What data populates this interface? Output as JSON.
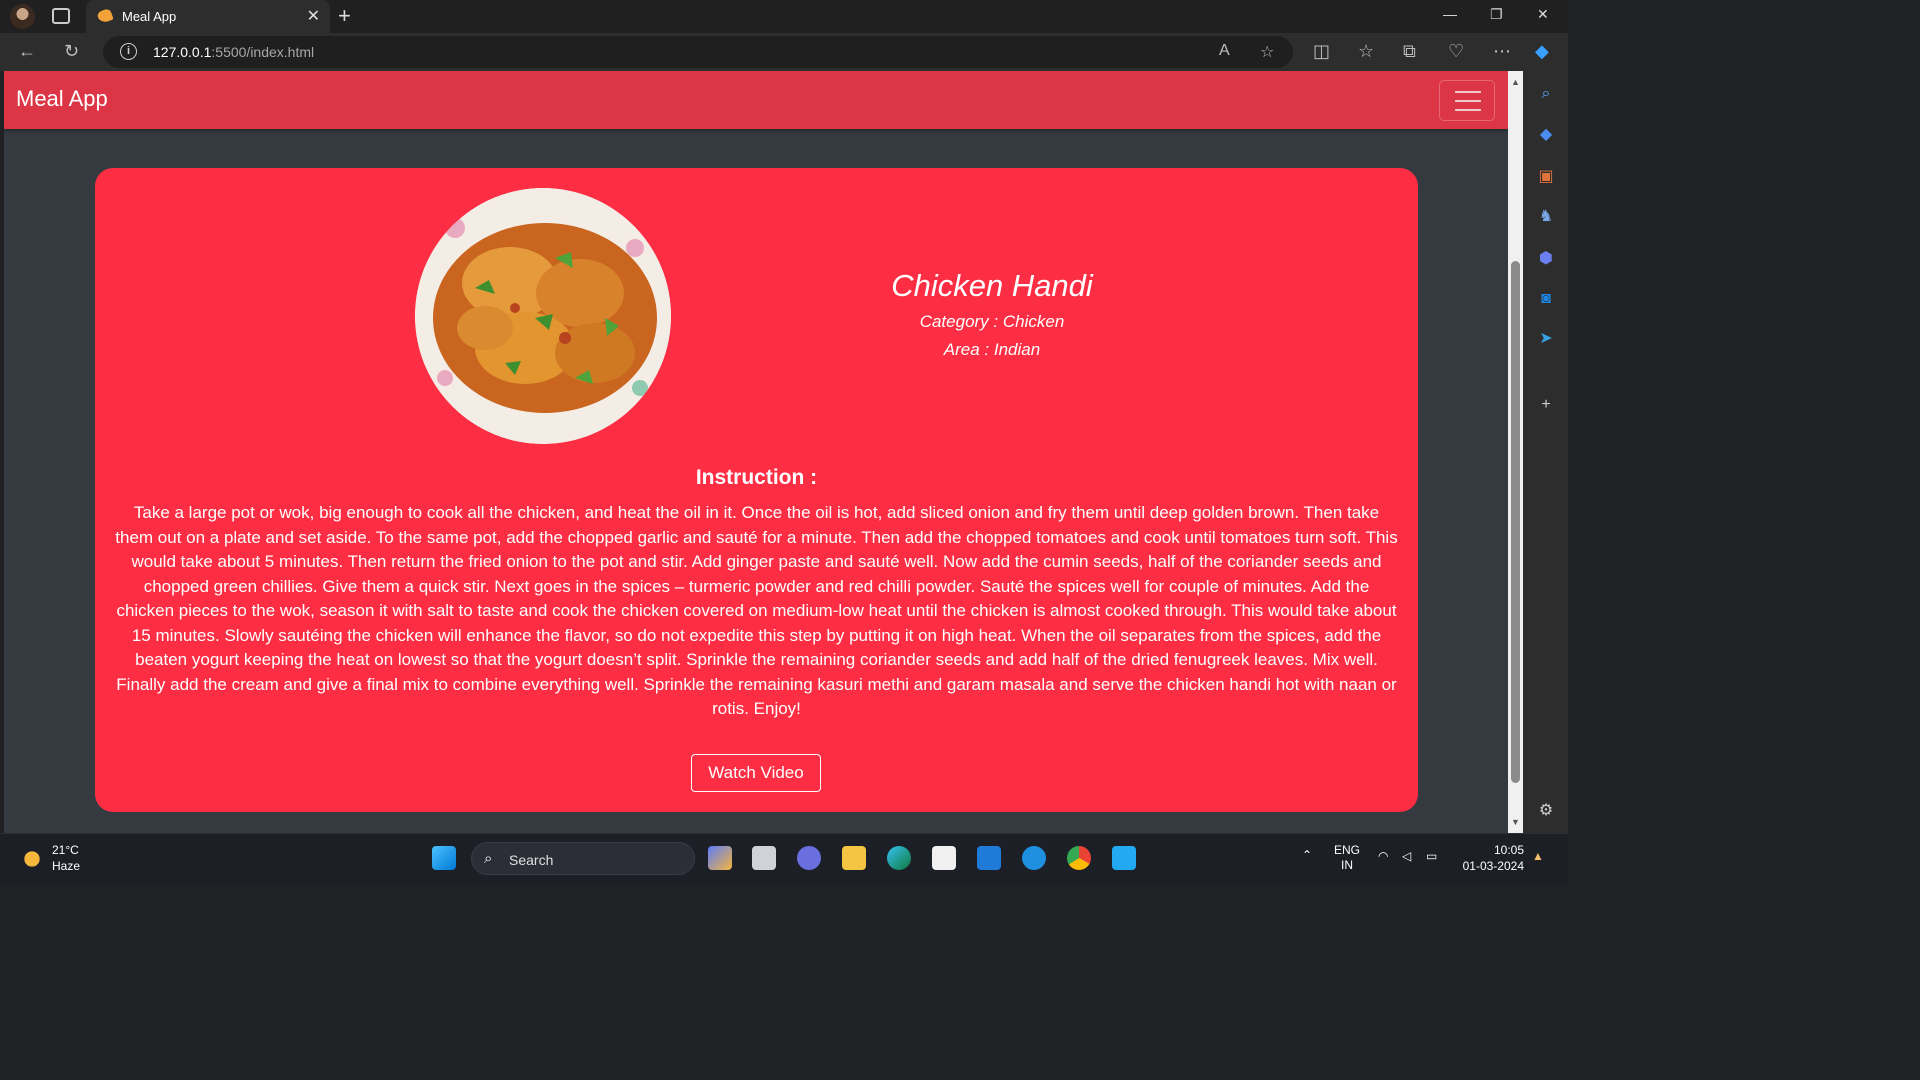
{
  "browser": {
    "tab_title": "Meal App",
    "url_host": "127.0.0.1",
    "url_rest": ":5500/index.html"
  },
  "app": {
    "brand": "Meal App"
  },
  "meal": {
    "name": "Chicken Handi",
    "category": "Category : Chicken",
    "area": "Area : Indian",
    "instruction_title": "Instruction :",
    "instructions": "Take a large pot or wok, big enough to cook all the chicken, and heat the oil in it. Once the oil is hot, add sliced onion and fry them until deep golden brown. Then take them out on a plate and set aside. To the same pot, add the chopped garlic and sauté for a minute. Then add the chopped tomatoes and cook until tomatoes turn soft. This would take about 5 minutes. Then return the fried onion to the pot and stir. Add ginger paste and sauté well. Now add the cumin seeds, half of the coriander seeds and chopped green chillies. Give them a quick stir. Next goes in the spices – turmeric powder and red chilli powder. Sauté the spices well for couple of minutes. Add the chicken pieces to the wok, season it with salt to taste and cook the chicken covered on medium-low heat until the chicken is almost cooked through. This would take about 15 minutes. Slowly sautéing the chicken will enhance the flavor, so do not expedite this step by putting it on high heat. When the oil separates from the spices, add the beaten yogurt keeping the heat on lowest so that the yogurt doesn’t split. Sprinkle the remaining coriander seeds and add half of the dried fenugreek leaves. Mix well. Finally add the cream and give a final mix to combine everything well. Sprinkle the remaining kasuri methi and garam masala and serve the chicken handi hot with naan or rotis. Enjoy!",
    "watch_label": "Watch Video"
  },
  "taskbar": {
    "temperature": "21°C",
    "weather": "Haze",
    "search_label": "Search",
    "lang_top": "ENG",
    "lang_bottom": "IN",
    "time": "10:05",
    "date": "01-03-2024"
  },
  "colors": {
    "navbar": "#dc3545",
    "card": "#fd2d44",
    "page_bg": "#343a40"
  }
}
